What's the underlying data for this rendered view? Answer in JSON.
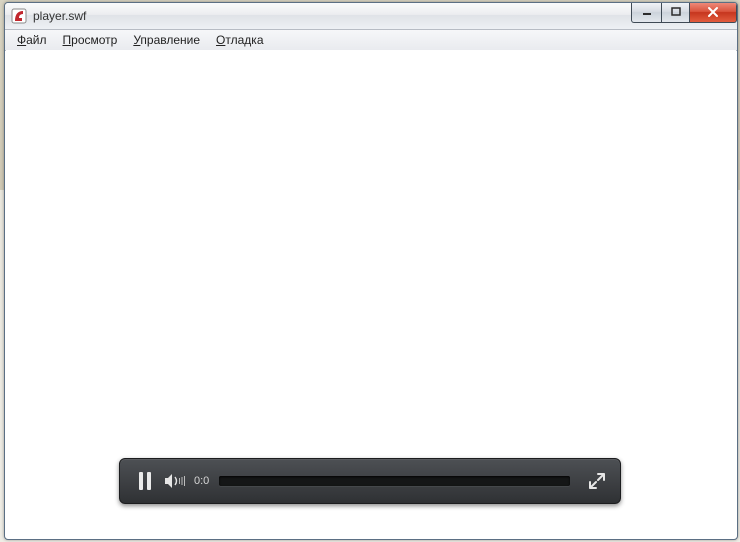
{
  "window": {
    "title": "player.swf"
  },
  "menubar": {
    "items": [
      {
        "hot": "Ф",
        "rest": "айл"
      },
      {
        "hot": "П",
        "rest": "росмотр"
      },
      {
        "hot": "У",
        "rest": "правление"
      },
      {
        "hot": "О",
        "rest": "тладка"
      }
    ]
  },
  "player": {
    "time": "0:0"
  }
}
